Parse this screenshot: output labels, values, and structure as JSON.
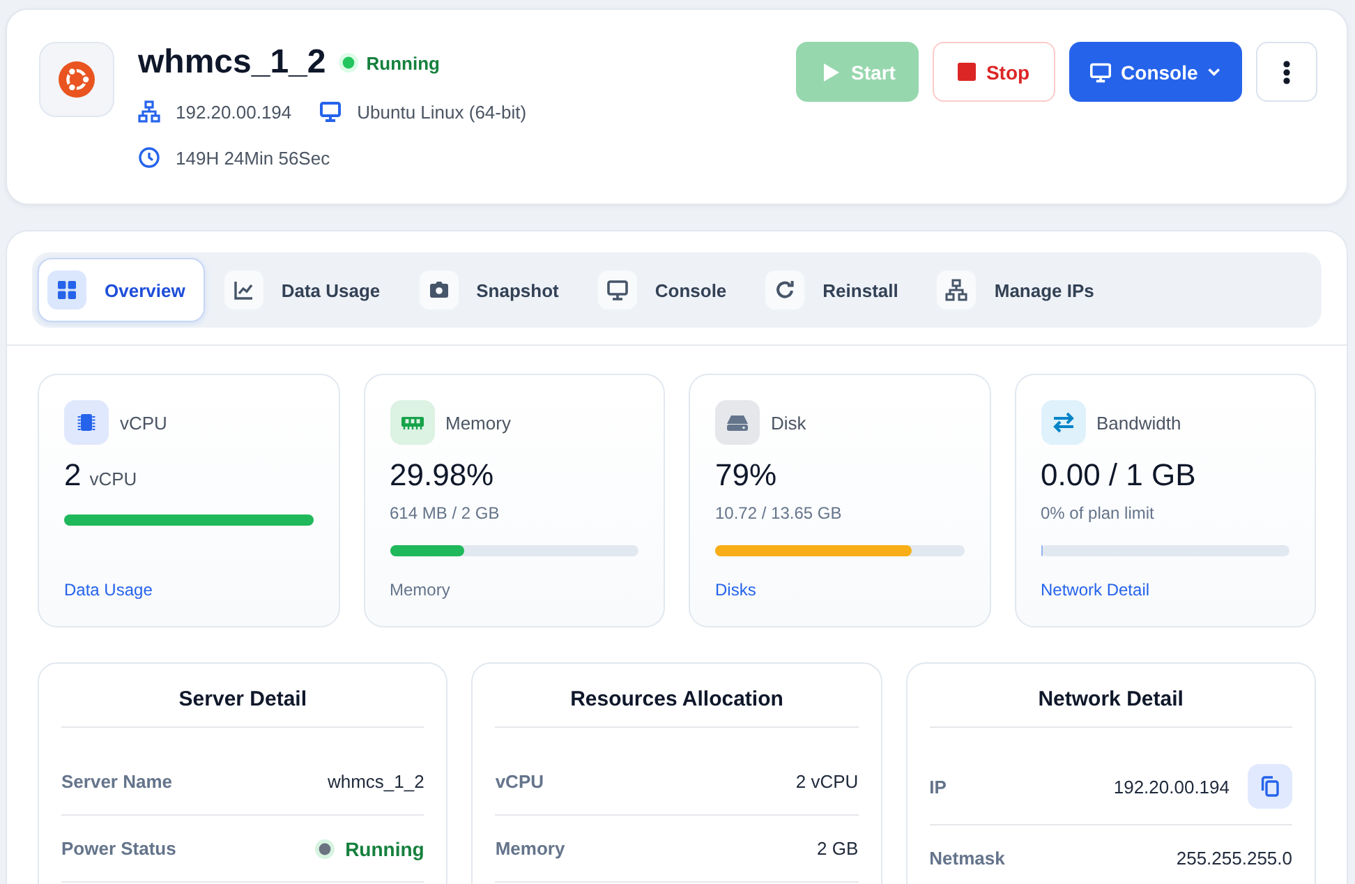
{
  "server": {
    "name": "whmcs_1_2",
    "status": "Running",
    "ip": "192.20.00.194",
    "os": "Ubuntu Linux (64-bit)",
    "uptime": "149H 24Min 56Sec"
  },
  "actions": [
    {
      "kind": "success",
      "label": "Start",
      "disabled": true,
      "dropdown": false
    },
    {
      "kind": "danger",
      "label": "Stop",
      "disabled": false,
      "dropdown": false
    },
    {
      "kind": "primary",
      "label": "Console",
      "disabled": false,
      "dropdown": true
    },
    {
      "kind": "more",
      "disabled": false,
      "dropdown": false
    }
  ],
  "tabs": [
    {
      "label": "Overview",
      "selected": true
    },
    {
      "label": "Data Usage",
      "selected": false
    },
    {
      "label": "Snapshot",
      "selected": false
    },
    {
      "label": "Console",
      "selected": false
    },
    {
      "label": "Reinstall",
      "selected": false
    },
    {
      "label": "Manage IPs",
      "selected": false
    }
  ],
  "stats": [
    {
      "label": "vCPU",
      "value": "2",
      "unit": "vCPU",
      "level": 1,
      "color": "#1fb85a",
      "footer": {
        "text": "Data Usage",
        "link": true
      }
    },
    {
      "label": "Memory",
      "value": "29.98%",
      "subtitle": "614 MB / 2 GB",
      "level": 0.2998,
      "color": "#1fb85a",
      "footer": {
        "text": "Memory",
        "link": false
      }
    },
    {
      "label": "Disk",
      "value": "79%",
      "subtitle": "10.72 / 13.65 GB",
      "level": 0.79,
      "color": "#f8ae17",
      "footer": {
        "text": "Disks",
        "link": true
      }
    },
    {
      "label": "Bandwidth",
      "value": "0.00 / 1 GB",
      "subtitle": "0% of plan limit",
      "level": 0,
      "footer": {
        "text": "Network Detail",
        "link": true
      }
    }
  ],
  "panels": [
    {
      "title": "Server Detail",
      "rows": [
        {
          "label": "Server Name",
          "value": "whmcs_1_2",
          "kind": "text"
        },
        {
          "label": "Power Status",
          "value": "Running",
          "kind": "status"
        }
      ]
    },
    {
      "title": "Resources Allocation",
      "rows": [
        {
          "label": "vCPU",
          "value": "2 vCPU",
          "kind": "text"
        },
        {
          "label": "Memory",
          "value": "2 GB",
          "kind": "text"
        }
      ]
    },
    {
      "title": "Network Detail",
      "rows": [
        {
          "label": "IP",
          "value": "192.20.00.194",
          "kind": "copy"
        },
        {
          "label": "Netmask",
          "value": "255.255.255.0",
          "kind": "text"
        }
      ]
    }
  ]
}
